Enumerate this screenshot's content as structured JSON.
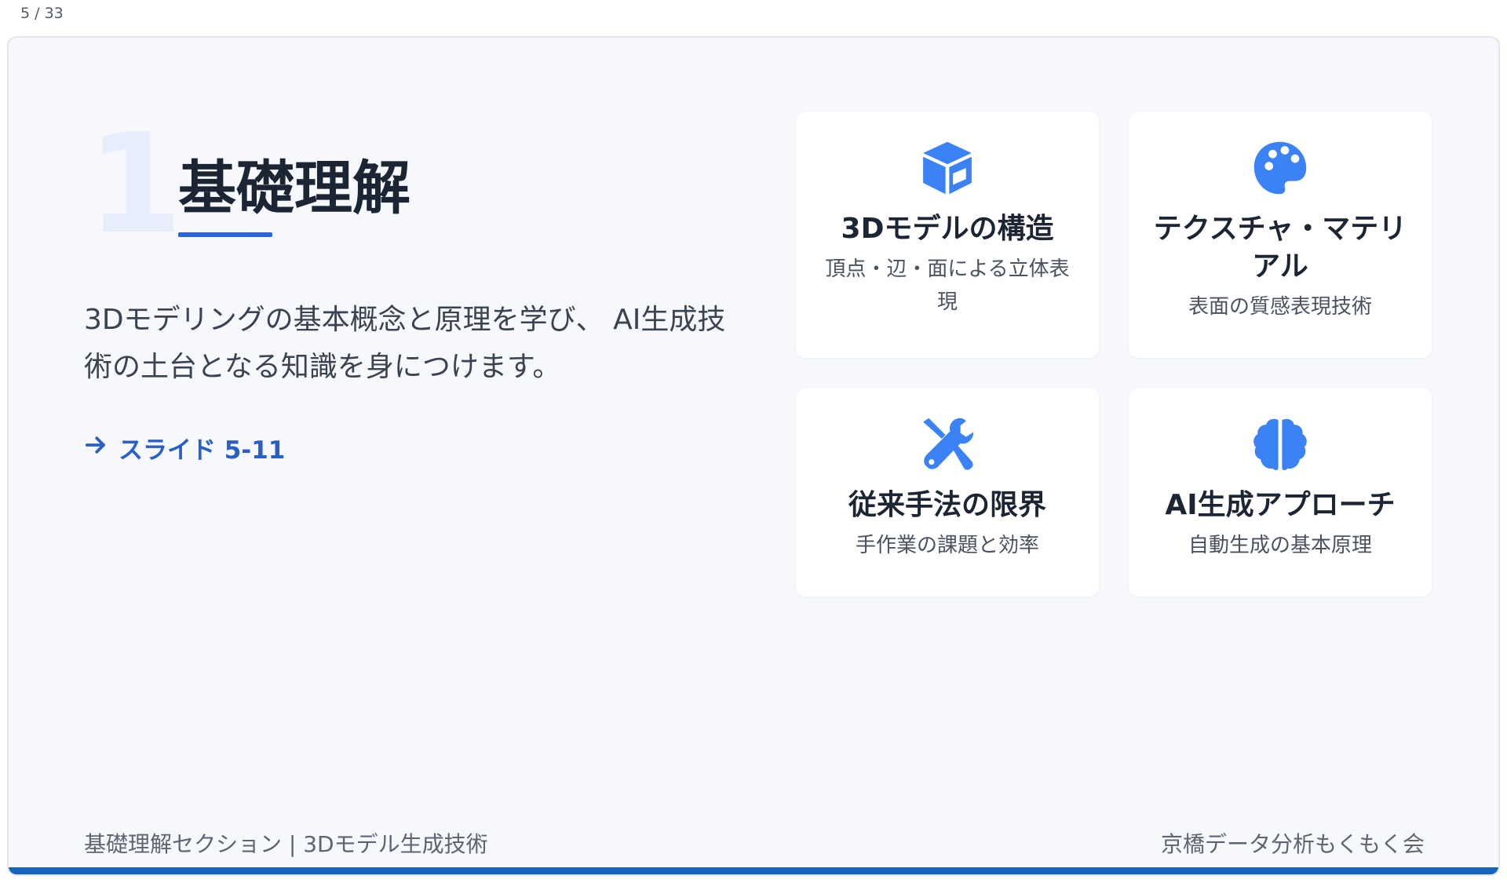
{
  "counter": "5 / 33",
  "section": {
    "number": "1",
    "title": "基礎理解",
    "description": "3Dモデリングの基本概念と原理を学び、 AI生成技術の土台となる知識を身につけます。",
    "link_label": "スライド 5-11"
  },
  "cards": [
    {
      "icon": "cube-icon",
      "title": "3Dモデルの構造",
      "subtitle": "頂点・辺・面による立体表現"
    },
    {
      "icon": "palette-icon",
      "title": "テクスチャ・マテリアル",
      "subtitle": "表面の質感表現技術"
    },
    {
      "icon": "tools-icon",
      "title": "従来手法の限界",
      "subtitle": "手作業の課題と効率"
    },
    {
      "icon": "brain-icon",
      "title": "AI生成アプローチ",
      "subtitle": "自動生成の基本原理"
    }
  ],
  "footer": {
    "left": "基礎理解セクション | 3Dモデル生成技術",
    "right": "京橋データ分析もくもく会"
  },
  "colors": {
    "accent": "#2b65d9",
    "icon": "#3b82f6",
    "bottom_bar": "#1565c0",
    "slide_bg": "#f6f8fc"
  }
}
